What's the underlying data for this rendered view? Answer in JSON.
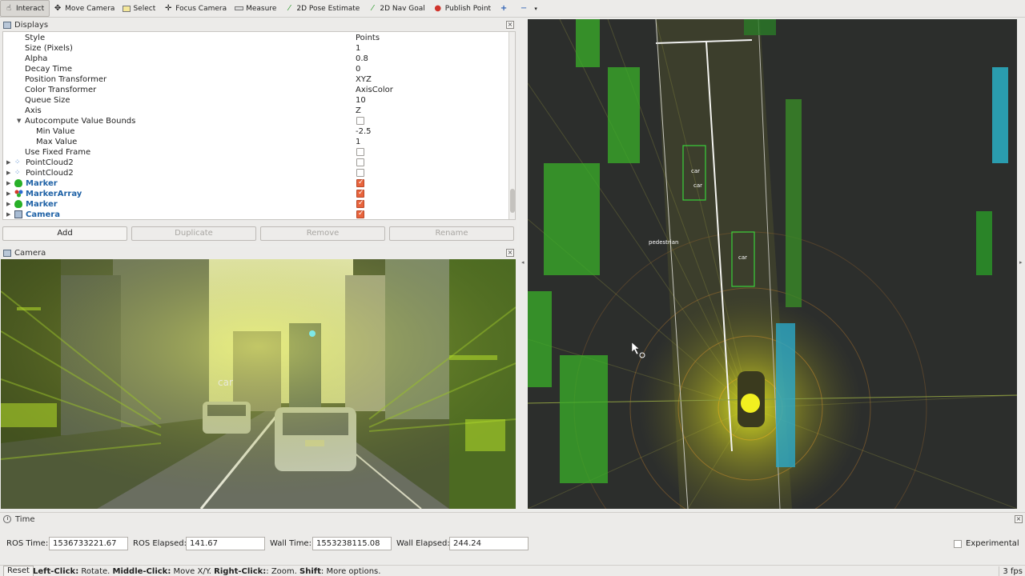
{
  "toolbar": {
    "items": [
      {
        "label": "Interact",
        "icon": "hand-pointer-icon"
      },
      {
        "label": "Move Camera",
        "icon": "move-camera-icon"
      },
      {
        "label": "Select",
        "icon": "select-box-icon"
      },
      {
        "label": "Focus Camera",
        "icon": "crosshair-icon"
      },
      {
        "label": "Measure",
        "icon": "ruler-icon"
      },
      {
        "label": "2D Pose Estimate",
        "icon": "green-arrow-icon"
      },
      {
        "label": "2D Nav Goal",
        "icon": "green-arrow-icon"
      },
      {
        "label": "Publish Point",
        "icon": "map-pin-icon"
      }
    ],
    "active": "Interact",
    "add_tool_icon": "plus-icon",
    "remove_tool_icon": "minus-icon"
  },
  "displays": {
    "title": "Displays",
    "properties": [
      {
        "key": "Style",
        "value": "Points"
      },
      {
        "key": "Size (Pixels)",
        "value": "1"
      },
      {
        "key": "Alpha",
        "value": "0.8"
      },
      {
        "key": "Decay Time",
        "value": "0"
      },
      {
        "key": "Position Transformer",
        "value": "XYZ"
      },
      {
        "key": "Color Transformer",
        "value": "AxisColor"
      },
      {
        "key": "Queue Size",
        "value": "10"
      },
      {
        "key": "Axis",
        "value": "Z"
      },
      {
        "key": "Autocompute Value Bounds",
        "value": ""
      },
      {
        "key": "Min Value",
        "value": "-2.5"
      },
      {
        "key": "Max Value",
        "value": "1"
      },
      {
        "key": "Use Fixed Frame",
        "value": ""
      }
    ],
    "items": [
      {
        "name": "PointCloud2",
        "checked": false,
        "icon": "pointcloud-icon",
        "highlight": false
      },
      {
        "name": "PointCloud2",
        "checked": false,
        "icon": "pointcloud-icon",
        "highlight": false
      },
      {
        "name": "Marker",
        "checked": true,
        "icon": "marker-icon",
        "highlight": true
      },
      {
        "name": "MarkerArray",
        "checked": true,
        "icon": "marker-array-icon",
        "highlight": true
      },
      {
        "name": "Marker",
        "checked": true,
        "icon": "marker-icon",
        "highlight": true
      },
      {
        "name": "Camera",
        "checked": true,
        "icon": "camera-icon",
        "highlight": true
      }
    ],
    "buttons": {
      "add": "Add",
      "duplicate": "Duplicate",
      "remove": "Remove",
      "rename": "Rename"
    }
  },
  "camera": {
    "title": "Camera",
    "labels": [
      "car"
    ]
  },
  "view3d": {
    "labels": [
      "car",
      "car",
      "car",
      "pedestrian"
    ]
  },
  "time": {
    "title": "Time",
    "ros_time_label": "ROS Time:",
    "ros_time": "1536733221.67",
    "ros_elapsed_label": "ROS Elapsed:",
    "ros_elapsed": "141.67",
    "wall_time_label": "Wall Time:",
    "wall_time": "1553238115.08",
    "wall_elapsed_label": "Wall Elapsed:",
    "wall_elapsed": "244.24",
    "experimental_label": "Experimental"
  },
  "status": {
    "reset": "Reset",
    "hint_1_bold": "Left-Click:",
    "hint_1": " Rotate. ",
    "hint_2_bold": "Middle-Click:",
    "hint_2": " Move X/Y. ",
    "hint_3_bold": "Right-Click:",
    "hint_3": ": Zoom. ",
    "hint_4_bold": "Shift",
    "hint_4": ": More options.",
    "fps": "3 fps"
  }
}
